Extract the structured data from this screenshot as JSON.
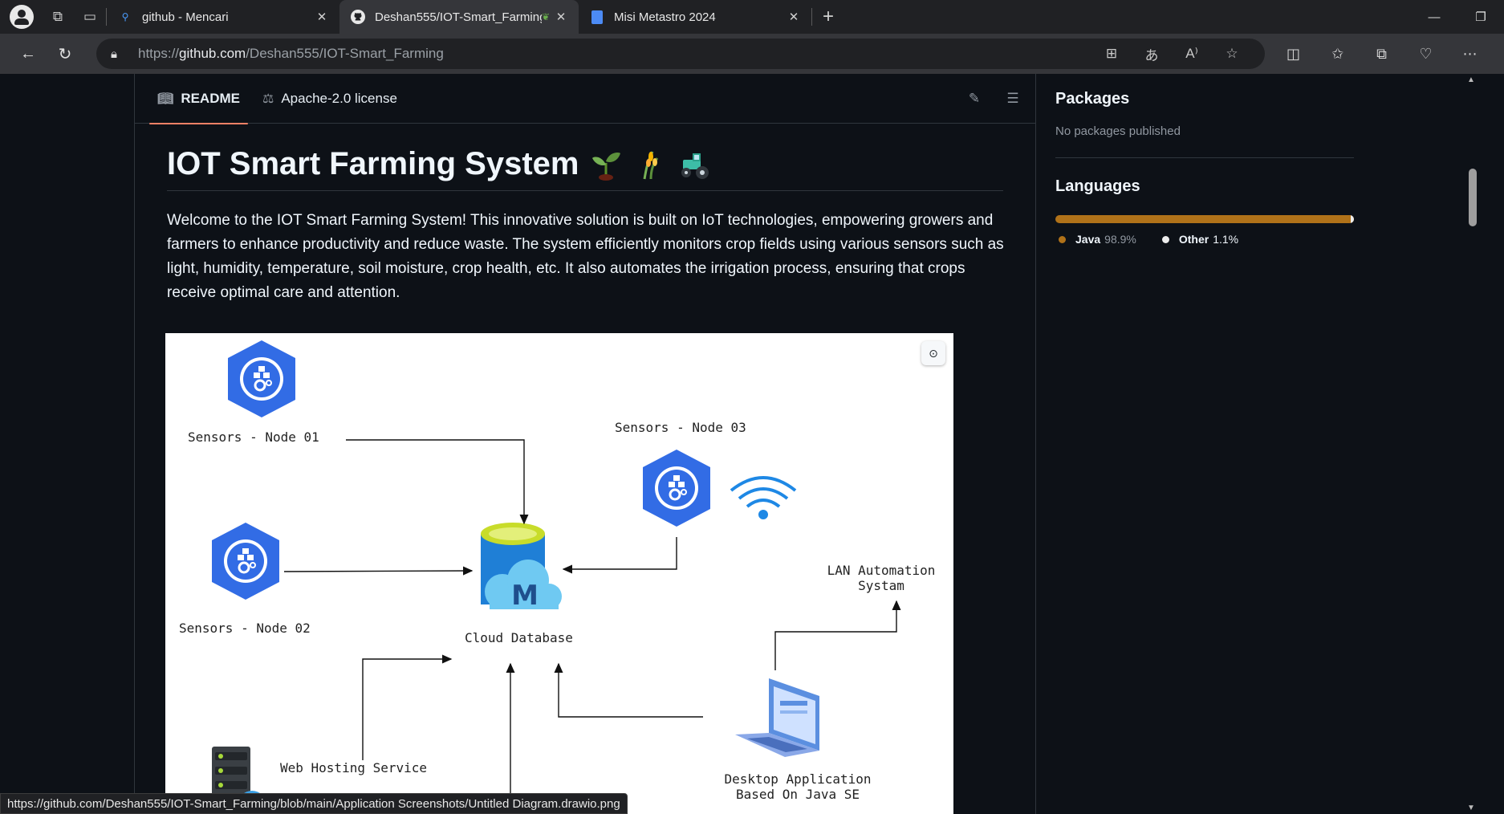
{
  "browser": {
    "tabs": [
      {
        "title": "github - Mencari",
        "favicon": "search-icon"
      },
      {
        "title": "Deshan555/IOT-Smart_Farming:",
        "favicon": "github-icon"
      },
      {
        "title": "Misi Metastro 2024",
        "favicon": "docs-icon"
      }
    ],
    "address": {
      "url_prefix": "https://",
      "url_host": "github.com",
      "url_path": "/Deshan555/IOT-Smart_Farming"
    },
    "status_url": "https://github.com/Deshan555/IOT-Smart_Farming/blob/main/Application Screenshots/Untitled Diagram.drawio.png"
  },
  "readme": {
    "tabs": [
      {
        "label": "README",
        "icon": "book-icon"
      },
      {
        "label": "Apache-2.0 license",
        "icon": "law-icon"
      }
    ],
    "title": "IOT Smart Farming System",
    "paragraph": "Welcome to the IOT Smart Farming System! This innovative solution is built on IoT technologies, empowering growers and farmers to enhance productivity and reduce waste. The system efficiently monitors crop fields using various sensors such as light, humidity, temperature, soil moisture, crop health, etc. It also automates the irrigation process, ensuring that crops receive optimal care and attention."
  },
  "diagram": {
    "labels": {
      "node1": "Sensors - Node 01",
      "node2": "Sensors - Node 02",
      "node3": "Sensors - Node 03",
      "cloud_db": "Cloud Database",
      "lan_line1": "LAN Automation",
      "lan_line2": "Systam",
      "web_hosting": "Web Hosting Service",
      "desktop_line1": "Desktop Application",
      "desktop_line2": "Based On Java SE"
    }
  },
  "sidebar": {
    "packages": {
      "title": "Packages",
      "text": "No packages published"
    },
    "languages": {
      "title": "Languages",
      "items": [
        {
          "name": "Java",
          "percent": "98.9%",
          "value": 98.9,
          "color": "#b07219"
        },
        {
          "name": "Other",
          "percent": "1.1%",
          "value": 1.1,
          "color": "#ededed"
        }
      ]
    }
  }
}
